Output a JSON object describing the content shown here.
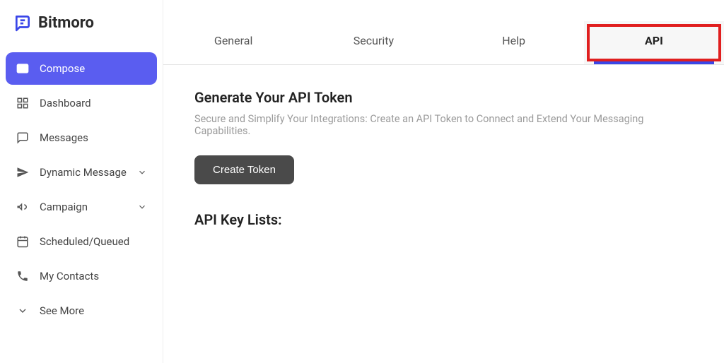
{
  "brand": {
    "name": "Bitmoro"
  },
  "sidebar": {
    "items": [
      {
        "label": "Compose",
        "icon": "mail-icon",
        "active": true,
        "expandable": false
      },
      {
        "label": "Dashboard",
        "icon": "grid-icon",
        "active": false,
        "expandable": false
      },
      {
        "label": "Messages",
        "icon": "message-icon",
        "active": false,
        "expandable": false
      },
      {
        "label": "Dynamic Message",
        "icon": "send-icon",
        "active": false,
        "expandable": true
      },
      {
        "label": "Campaign",
        "icon": "campaign-icon",
        "active": false,
        "expandable": true
      },
      {
        "label": "Scheduled/Queued",
        "icon": "calendar-icon",
        "active": false,
        "expandable": false
      },
      {
        "label": "My Contacts",
        "icon": "phone-icon",
        "active": false,
        "expandable": false
      },
      {
        "label": "See More",
        "icon": "chevron-down-icon",
        "active": false,
        "expandable": false
      }
    ]
  },
  "tabs": [
    {
      "label": "General",
      "active": false
    },
    {
      "label": "Security",
      "active": false
    },
    {
      "label": "Help",
      "active": false
    },
    {
      "label": "API",
      "active": true,
      "highlighted": true
    }
  ],
  "api": {
    "title": "Generate Your API Token",
    "subtitle": "Secure and Simplify Your Integrations: Create an API Token to Connect and Extend Your Messaging Capabilities.",
    "create_label": "Create Token",
    "list_title": "API Key Lists:"
  },
  "colors": {
    "primary": "#5a5df0",
    "tab_underline": "#3a46e8",
    "highlight_border": "#e01f1f",
    "button_dark": "#4a4a4a"
  }
}
